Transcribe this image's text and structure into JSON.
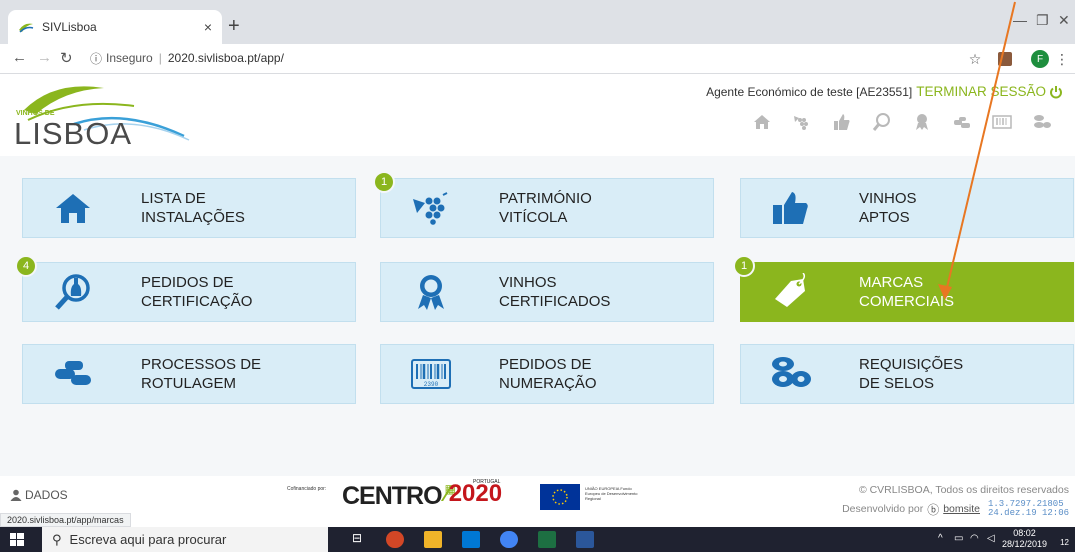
{
  "browser": {
    "tab_title": "SIVLisboa",
    "tab_close": "×",
    "new_tab": "+",
    "address_security": "Inseguro",
    "address_url": "2020.sivlisboa.pt/app/",
    "profile_initial": "F",
    "window_min": "—",
    "window_restore": "❐",
    "window_close": "✕",
    "status_url": "2020.sivlisboa.pt/app/marcas"
  },
  "header": {
    "logo_small": "VINHOS DE",
    "logo_big": "LISBOA",
    "agent_text": "Agente Económico de teste [AE23551]",
    "logout_label": "TERMINAR SESSÃO"
  },
  "tiles": [
    {
      "line1": "LISTA DE",
      "line2": "INSTALAÇÕES",
      "badge": ""
    },
    {
      "line1": "PATRIMÓNIO",
      "line2": "VITÍCOLA",
      "badge": "1"
    },
    {
      "line1": "VINHOS",
      "line2": "APTOS",
      "badge": ""
    },
    {
      "line1": "PEDIDOS DE",
      "line2": "CERTIFICAÇÃO",
      "badge": "4"
    },
    {
      "line1": "VINHOS",
      "line2": "CERTIFICADOS",
      "badge": ""
    },
    {
      "line1": "MARCAS",
      "line2": "COMERCIAIS",
      "badge": "1"
    },
    {
      "line1": "PROCESSOS DE",
      "line2": "ROTULAGEM",
      "badge": ""
    },
    {
      "line1": "PEDIDOS DE",
      "line2": "NUMERAÇÃO",
      "badge": ""
    },
    {
      "line1": "REQUISIÇÕES",
      "line2": "DE SELOS",
      "badge": ""
    }
  ],
  "barcode_digits": "2390",
  "footer": {
    "dados_label": "DADOS",
    "cofinanciado": "Cofinanciado por:",
    "centro": "CENTRO",
    "portugal": "PORTUGAL",
    "pt2020": "2020",
    "eu_text": "UNIÃO EUROPEIA Fundo Europeu de Desenvolvimento Regional",
    "copyright": "© CVRLISBOA, Todos os direitos reservados",
    "developed_by": "Desenvolvido por",
    "developer": "bomsite",
    "version_line1": "1.3.7297.21805",
    "version_line2": "24.dez.19 12:06"
  },
  "taskbar": {
    "search_placeholder": "Escreva aqui para procurar",
    "time": "08:02",
    "date": "28/12/2019",
    "notifications": "12"
  },
  "colors": {
    "accent": "#8bb61e",
    "tile_bg": "#d9edf7",
    "icon_blue": "#1e6fb5",
    "arrow": "#e87722"
  }
}
